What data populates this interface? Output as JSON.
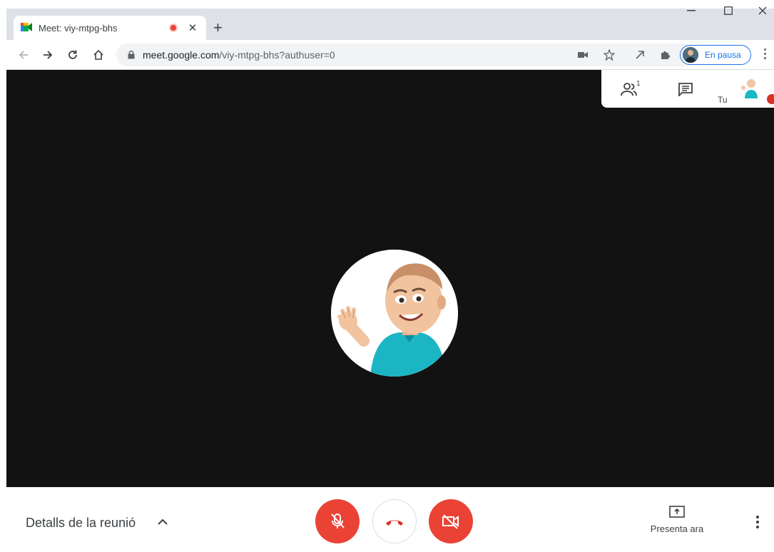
{
  "browser": {
    "tab_title": "Meet: viy-mtpg-bhs",
    "new_tab_label": "+",
    "url_host": "meet.google.com",
    "url_path": "/viy-mtpg-bhs?authuser=0",
    "profile_status": "En pausa",
    "icons": [
      "meet-favicon",
      "recording-dot-icon",
      "close-icon",
      "back-icon",
      "forward-icon",
      "reload-icon",
      "home-icon",
      "lock-icon",
      "camera-icon",
      "star-icon",
      "extension-icon",
      "puzzle-icon",
      "kebab-menu-icon",
      "minimize-icon",
      "maximize-icon",
      "window-close-icon"
    ]
  },
  "meeting": {
    "people_count": "1",
    "you_label": "Tu",
    "details_label": "Detalls de la reunió",
    "present_label": "Presenta ara",
    "mic_state": "muted",
    "camera_state": "off"
  },
  "colors": {
    "accent_red": "#ea4335",
    "video_background": "#121212",
    "profile_blue": "#1a73e8"
  }
}
